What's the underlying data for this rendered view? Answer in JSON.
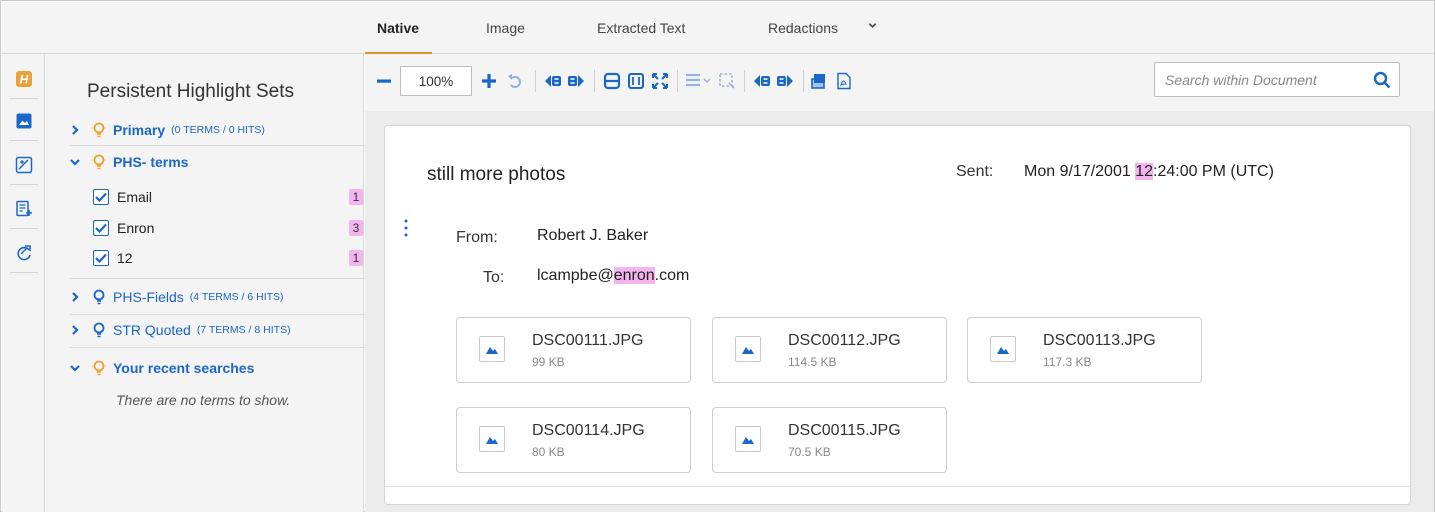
{
  "tabs": [
    {
      "label": "Native",
      "active": true
    },
    {
      "label": "Image",
      "active": false
    },
    {
      "label": "Extracted Text",
      "active": false
    },
    {
      "label": "Redactions",
      "active": false
    }
  ],
  "rail": {
    "items": [
      "highlight-sets-icon",
      "image-icon",
      "compare-image-icon",
      "add-note-icon",
      "refresh-icon"
    ],
    "brand_letter": "H"
  },
  "panel": {
    "title": "Persistent Highlight Sets",
    "sets": [
      {
        "name": "Primary",
        "counts": "(0 TERMS / 0 HITS)",
        "expanded": false,
        "active": true
      },
      {
        "name": "PHS- terms",
        "counts": "",
        "expanded": true,
        "active": true,
        "terms": [
          {
            "label": "Email",
            "hits": "1",
            "checked": true
          },
          {
            "label": "Enron",
            "hits": "3",
            "checked": true
          },
          {
            "label": "12",
            "hits": "1",
            "checked": true
          }
        ]
      },
      {
        "name": "PHS-Fields",
        "counts": "(4 TERMS / 6 HITS)",
        "expanded": false,
        "active": false
      },
      {
        "name": "STR Quoted",
        "counts": "(7 TERMS / 8 HITS)",
        "expanded": false,
        "active": false
      },
      {
        "name": "Your recent searches",
        "counts": "",
        "expanded": true,
        "active": true
      }
    ],
    "empty_message": "There are no terms to show."
  },
  "toolbar": {
    "zoom": "100%",
    "search_placeholder": "Search within Document"
  },
  "document": {
    "subject": "still more photos",
    "sent_label": "Sent:",
    "sent_pre": "Mon 9/17/2001 ",
    "sent_hl": "12",
    "sent_post": ":24:00 PM (UTC)",
    "from_label": "From:",
    "from_value": "Robert J. Baker",
    "to_label": "To:",
    "to_pre": "lcampbe@",
    "to_hl": "enron",
    "to_post": ".com",
    "attachments": [
      {
        "name": "DSC00111.JPG",
        "size": "99 KB"
      },
      {
        "name": "DSC00112.JPG",
        "size": "114.5 KB"
      },
      {
        "name": "DSC00113.JPG",
        "size": "117.3 KB"
      },
      {
        "name": "DSC00114.JPG",
        "size": "80 KB"
      },
      {
        "name": "DSC00115.JPG",
        "size": "70.5 KB"
      }
    ]
  },
  "colors": {
    "accent": "#e7912b",
    "link": "#1b66c9",
    "highlight": "#f4b4ef",
    "bulb": "#f0a030"
  }
}
